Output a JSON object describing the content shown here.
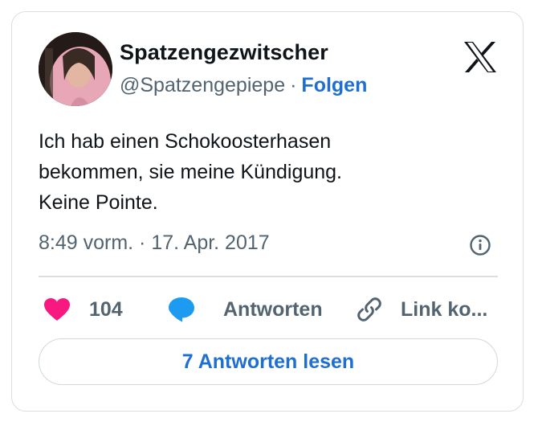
{
  "author": {
    "display_name": "Spatzengezwitscher",
    "handle": "@Spatzengepiepe",
    "separator": "·",
    "follow_label": "Folgen"
  },
  "tweet": {
    "lines": [
      "Ich hab einen Schokoosterhasen",
      "bekommen, sie meine Kündigung.",
      "Keine Pointe."
    ],
    "timestamp": "8:49 vorm. · 17. Apr. 2017"
  },
  "actions": {
    "like_count": "104",
    "reply_label": "Antworten",
    "copy_link_label": "Link ko..."
  },
  "read_replies_label": "7 Antworten lesen",
  "icons": {
    "brand": "x-logo-icon",
    "info": "info-icon",
    "like": "heart-icon",
    "reply": "speech-bubble-icon",
    "link": "link-icon"
  },
  "colors": {
    "text": "#0f1419",
    "secondary": "#536471",
    "accent_blue": "#1d6fd1",
    "heart": "#f91880",
    "reply_icon": "#1d9bf0",
    "border": "#d9dee2"
  }
}
